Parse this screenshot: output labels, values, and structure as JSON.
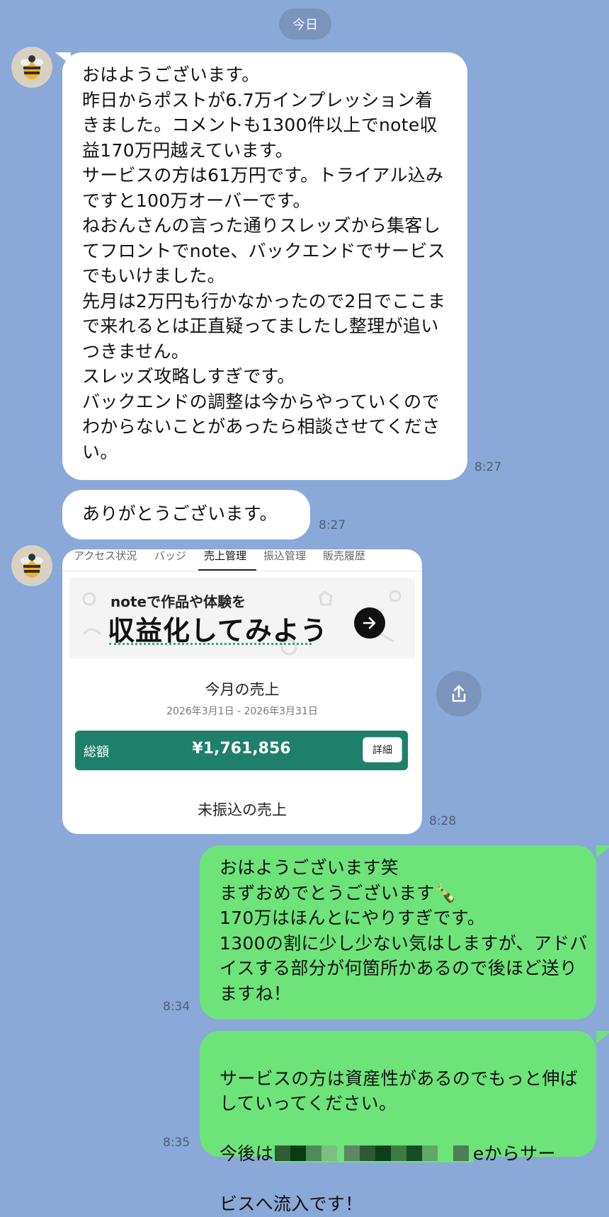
{
  "date_separator": "今日",
  "messages": [
    {
      "side": "in",
      "text": "おはようございます。\n昨日からポストが6.7万インプレッション着きました。コメントも1300件以上でnote収益170万円越えています。\nサービスの方は61万円です。トライアル込みですと100万オーバーです。\nねおんさんの言った通りスレッズから集客してフロントでnote、バックエンドでサービスでもいけました。\n先月は2万円も行かなかったので2日でここまで来れるとは正直疑ってましたし整理が追いつきません。\nスレッズ攻略しすぎです。\nバックエンドの調整は今からやっていくのでわからないことがあったら相談させてください。",
      "time": "8:27"
    },
    {
      "side": "in",
      "text": "ありがとうございます。",
      "time": "8:27"
    },
    {
      "side": "in",
      "type": "image",
      "time": "8:28",
      "screenshot": {
        "tabs": [
          "アクセス状況",
          "バッジ",
          "売上管理",
          "振込管理",
          "販売履歴"
        ],
        "active_tab": "売上管理",
        "banner_small": "noteで作品や体験を",
        "banner_big": "収益化してみよう",
        "month_title": "今月の売上",
        "month_range": "2026年3月1日 - 2026年3月31日",
        "total_label": "総額",
        "total_value": "¥1,761,856",
        "detail_button": "詳細",
        "unpaid_title": "未振込の売上"
      }
    },
    {
      "side": "out",
      "text": "おはようございます笑\nまずおめでとうございます🍾\n170万はほんとにやりすぎです。\n1300の割に少し少ない気はしますが、アドバイスする部分が何箇所かあるので後ほど送りますね！",
      "time": "8:34"
    },
    {
      "side": "out",
      "text_line1": "サービスの方は資産性があるのでもっと伸ばしていってください。",
      "text_line2_prefix": "今後は",
      "text_line2_suffix": "eからサー",
      "text_line3": "ビスへ流入です！",
      "time": "8:35"
    }
  ],
  "icons": [
    "bee-avatar-icon",
    "share-icon",
    "arrow-right-icon"
  ],
  "colors": {
    "background": "#8aa8d8",
    "incoming": "#ffffff",
    "outgoing": "#6de37a",
    "total_bar": "#1e7f6b"
  }
}
